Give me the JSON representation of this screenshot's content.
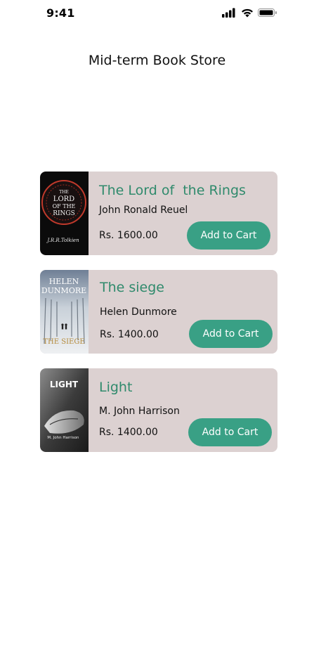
{
  "status_bar": {
    "time": "9:41",
    "icons": [
      "cellular-signal-icon",
      "wifi-icon",
      "battery-icon"
    ]
  },
  "header": {
    "title": "Mid-term Book Store"
  },
  "colors": {
    "card_bg": "#dcd1d1",
    "title_green": "#2f8a6c",
    "button_green": "#39a085"
  },
  "books": [
    {
      "title": "The Lord of  the Rings",
      "author": "John Ronald Reuel",
      "price": "Rs. 1600.00",
      "button_label": "Add to Cart",
      "cover": {
        "lines": [
          "THE",
          "LORD",
          "OF THE",
          "RINGS"
        ],
        "signature": "J.R.R.Tolkien"
      }
    },
    {
      "title": "The siege",
      "author": "Helen Dunmore",
      "price": "Rs. 1400.00",
      "button_label": "Add to Cart",
      "cover": {
        "author_top": "HELEN",
        "author_bottom": "DUNMORE",
        "title": "THE SIEGE"
      }
    },
    {
      "title": "Light",
      "author": "M. John Harrison",
      "price": "Rs. 1400.00",
      "button_label": "Add to Cart",
      "cover": {
        "title": "LIGHT",
        "author": "M. John Harrison"
      }
    }
  ]
}
